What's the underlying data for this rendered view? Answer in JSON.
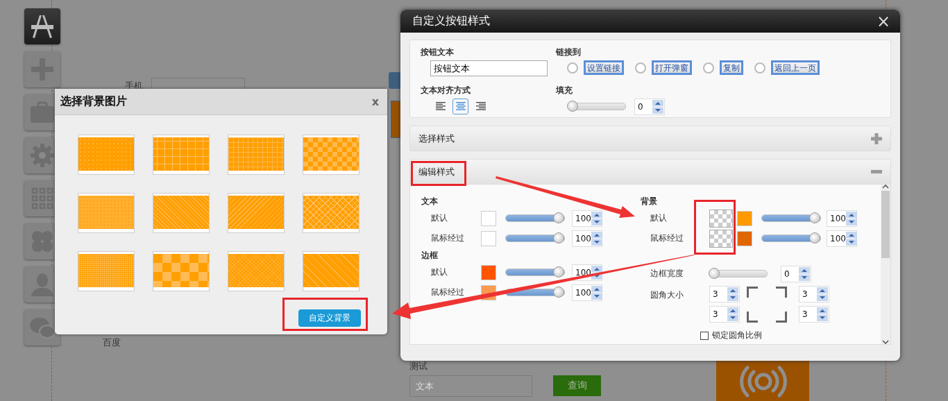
{
  "sidebar": {
    "items": [
      {
        "kind": "tools",
        "selected": true
      },
      {
        "kind": "plus",
        "selected": false
      },
      {
        "kind": "briefcase",
        "selected": false
      },
      {
        "kind": "gear",
        "selected": false
      },
      {
        "kind": "grid",
        "selected": false
      },
      {
        "kind": "clover",
        "selected": false
      },
      {
        "kind": "user",
        "selected": false
      },
      {
        "kind": "chat",
        "selected": false
      }
    ]
  },
  "background_page": {
    "phone_label": "手机",
    "baidu_label": "百度",
    "test_label": "测试",
    "search_field": {
      "placeholder": "文本"
    },
    "search_button": "查询"
  },
  "background_dialog": {
    "title": "选择背景图片",
    "close": "x",
    "patterns": [
      {
        "kind": "dots"
      },
      {
        "kind": "crosses"
      },
      {
        "kind": "plaid"
      },
      {
        "kind": "checker-small"
      },
      {
        "kind": "dots-light"
      },
      {
        "kind": "diagonal-mesh"
      },
      {
        "kind": "diagonal-right"
      },
      {
        "kind": "lattice"
      },
      {
        "kind": "fine-dots"
      },
      {
        "kind": "checker-large"
      },
      {
        "kind": "diamond"
      },
      {
        "kind": "diagonal-left"
      }
    ],
    "custom_button": "自定义背景"
  },
  "style_dialog": {
    "title": "自定义按钮样式",
    "close": "×",
    "button_text": {
      "label": "按钮文本",
      "value": "按钮文本"
    },
    "link_to": {
      "label": "链接到",
      "options": [
        {
          "label": "设置链接",
          "selected": false
        },
        {
          "label": "打开弹窗",
          "selected": false
        },
        {
          "label": "复制",
          "selected": false
        },
        {
          "label": "返回上一页",
          "selected": false
        }
      ]
    },
    "align": {
      "label": "文本对齐方式",
      "options": [
        {
          "kind": "left",
          "selected": false
        },
        {
          "kind": "center",
          "selected": true
        },
        {
          "kind": "right",
          "selected": false
        }
      ]
    },
    "padding": {
      "label": "填充",
      "level": 0,
      "value": "0"
    },
    "sections": [
      {
        "title": "选择样式",
        "expanded": false
      },
      {
        "title": "编辑样式",
        "expanded": true
      }
    ],
    "edit": {
      "text": {
        "title": "文本",
        "rows": [
          {
            "label": "默认",
            "color": "#ffffff",
            "level": 1,
            "value": "100"
          },
          {
            "label": "鼠标经过",
            "color": "#ffffff",
            "level": 1,
            "value": "100"
          }
        ]
      },
      "border": {
        "title": "边框",
        "rows": [
          {
            "label": "默认",
            "color": "#ff5500",
            "level": 1,
            "value": "100"
          },
          {
            "label": "鼠标经过",
            "color": "#f99b4f",
            "level": 1,
            "value": "100"
          }
        ]
      },
      "background": {
        "title": "背景",
        "rows": [
          {
            "label": "默认",
            "color": "#ff9900",
            "level": 1,
            "value": "100"
          },
          {
            "label": "鼠标经过",
            "color": "#e06600",
            "level": 1,
            "value": "100"
          }
        ]
      },
      "border_width": {
        "label": "边框宽度",
        "level": 0,
        "value": "0"
      },
      "radius": {
        "label": "圆角大小",
        "values": [
          "3",
          "3",
          "3",
          "3"
        ]
      },
      "lock_ratio": {
        "label": "锁定圆角比例",
        "checked": false
      }
    }
  }
}
